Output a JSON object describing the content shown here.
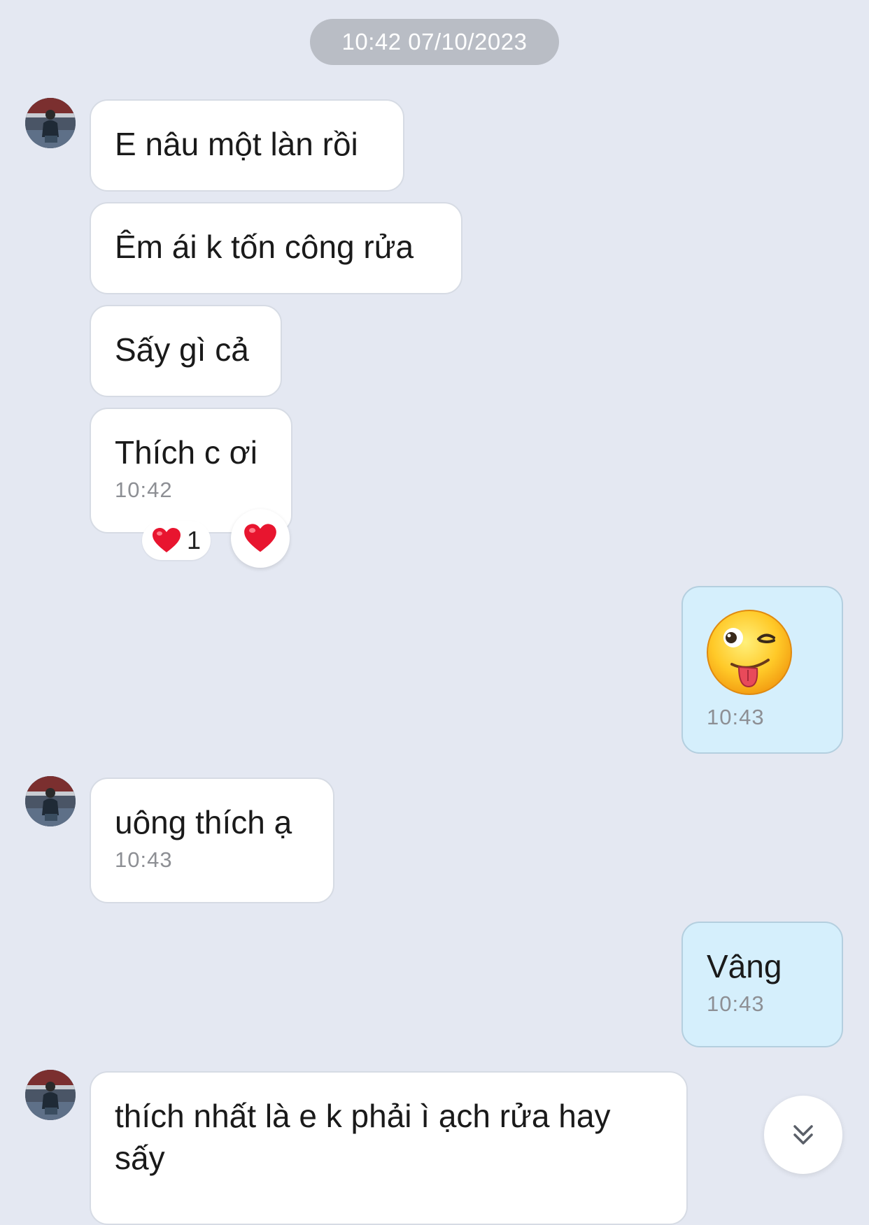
{
  "date_separator": "10:42 07/10/2023",
  "messages": [
    {
      "sender": "other",
      "text": "E nâu một làn rồi",
      "show_avatar": true
    },
    {
      "sender": "other",
      "text": "Êm ái k tốn công rửa"
    },
    {
      "sender": "other",
      "text": "Sấy gì cả"
    },
    {
      "sender": "other",
      "text": "Thích c ơi",
      "time": "10:42",
      "reaction": {
        "icon": "heart-icon",
        "count": "1"
      }
    },
    {
      "sender": "me",
      "sticker": "winking-tongue-emoji",
      "time": "10:43"
    },
    {
      "sender": "other",
      "text": "uông thích ạ",
      "time": "10:43",
      "show_avatar": true
    },
    {
      "sender": "me",
      "text": "Vâng",
      "time": "10:43"
    },
    {
      "sender": "other",
      "text": "thích nhất là e k phải ì ạch rửa hay sấy",
      "show_avatar": true
    }
  ],
  "colors": {
    "background": "#e4e8f2",
    "incoming_bubble": "#ffffff",
    "outgoing_bubble": "#d5effc",
    "heart": "#e8152f"
  },
  "icons": {
    "react_button": "heart-icon",
    "scroll_down": "double-chevron-down-icon"
  }
}
